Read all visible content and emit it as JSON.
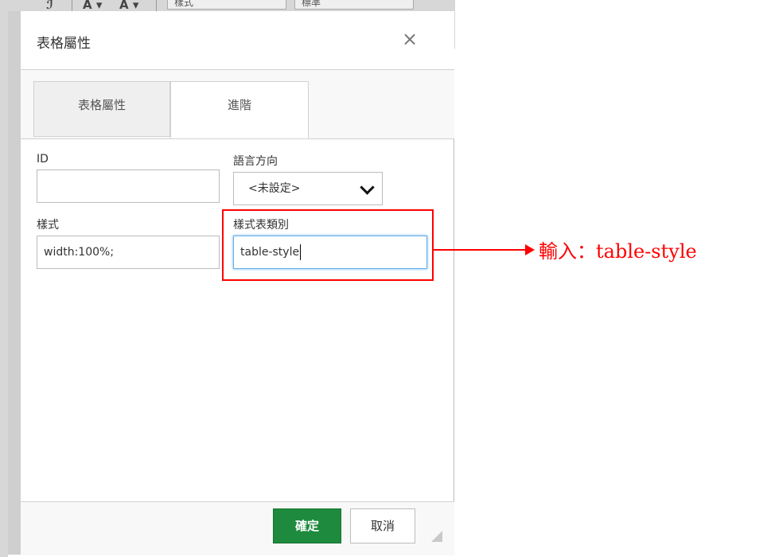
{
  "toolbar_bg": {
    "style_select": "樣式",
    "format_select": "標準"
  },
  "dialog": {
    "title": "表格屬性",
    "close_symbol": "×",
    "tabs": [
      {
        "label": "表格屬性",
        "active": false
      },
      {
        "label": "進階",
        "active": true
      }
    ],
    "fields": {
      "id_label": "ID",
      "id_value": "",
      "lang_dir_label": "語言方向",
      "lang_dir_value": "<未設定>",
      "style_label": "樣式",
      "style_value": "width:100%;",
      "css_class_label": "樣式表類別",
      "css_class_value": "table-style"
    },
    "buttons": {
      "ok": "確定",
      "cancel": "取消"
    }
  },
  "annotation": {
    "text": "輸入：table-style",
    "color": "#ff0000"
  },
  "colors": {
    "ok_button": "#1e8a3d",
    "focus_border": "#66afe9"
  }
}
